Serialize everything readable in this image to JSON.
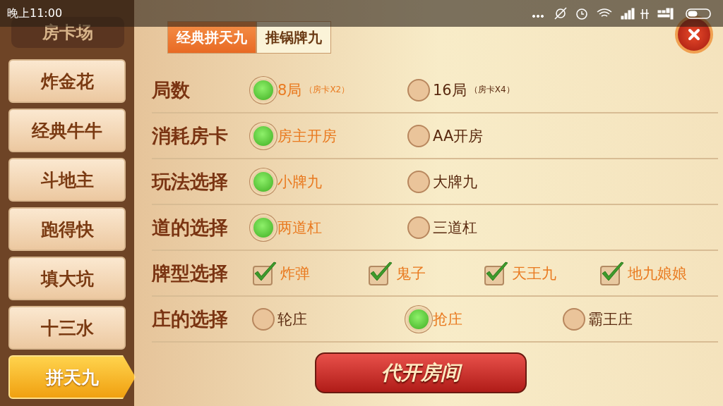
{
  "status_bar": {
    "time": "晚上11:00"
  },
  "sidebar": {
    "title": "房卡场",
    "items": [
      {
        "label": "炸金花",
        "selected": false
      },
      {
        "label": "经典牛牛",
        "selected": false
      },
      {
        "label": "斗地主",
        "selected": false
      },
      {
        "label": "跑得快",
        "selected": false
      },
      {
        "label": "填大坑",
        "selected": false
      },
      {
        "label": "十三水",
        "selected": false
      },
      {
        "label": "拼天九",
        "selected": true
      }
    ]
  },
  "tabs": [
    {
      "label": "经典拼天九",
      "selected": true
    },
    {
      "label": "推锅牌九",
      "selected": false
    }
  ],
  "settings": [
    {
      "label": "局数",
      "kind": "radio",
      "options": [
        {
          "label": "8局",
          "note": "（房卡X2）",
          "selected": true
        },
        {
          "label": "16局",
          "note": "（房卡X4）",
          "selected": false
        }
      ]
    },
    {
      "label": "消耗房卡",
      "kind": "radio",
      "options": [
        {
          "label": "房主开房",
          "selected": true
        },
        {
          "label": "AA开房",
          "selected": false
        }
      ]
    },
    {
      "label": "玩法选择",
      "kind": "radio",
      "options": [
        {
          "label": "小牌九",
          "selected": true
        },
        {
          "label": "大牌九",
          "selected": false
        }
      ]
    },
    {
      "label": "道的选择",
      "kind": "radio",
      "options": [
        {
          "label": "两道杠",
          "selected": true
        },
        {
          "label": "三道杠",
          "selected": false
        }
      ]
    },
    {
      "label": "牌型选择",
      "kind": "checkbox",
      "options": [
        {
          "label": "炸弹",
          "selected": true
        },
        {
          "label": "鬼子",
          "selected": true
        },
        {
          "label": "天王九",
          "selected": true
        },
        {
          "label": "地九娘娘",
          "selected": true
        }
      ]
    },
    {
      "label": "庄的选择",
      "kind": "radio3",
      "options": [
        {
          "label": "轮庄",
          "selected": false
        },
        {
          "label": "抢庄",
          "selected": true
        },
        {
          "label": "霸王庄",
          "selected": false
        }
      ]
    }
  ],
  "action_button": "代开房间"
}
